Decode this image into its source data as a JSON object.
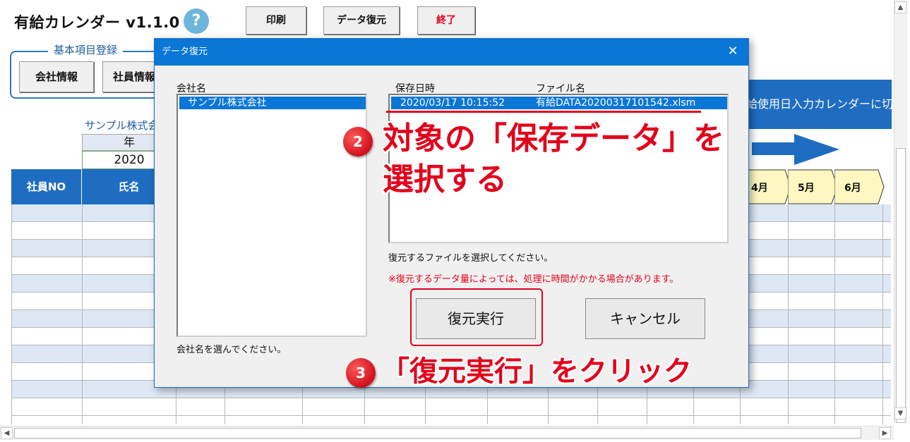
{
  "app": {
    "title": "有給カレンダー v1.1.0",
    "help_icon": "?",
    "buttons": {
      "print": "印刷",
      "restore": "データ復元",
      "exit": "終了"
    }
  },
  "basic_group": {
    "title": "基本項目登録",
    "company_info": "会社情報",
    "employee_info": "社員情報"
  },
  "sheet": {
    "company_name": "サンプル株式会",
    "year_header": "年",
    "year_value": "2020",
    "col_employee_no": "社員NO",
    "col_name": "氏名",
    "banner": "給使用日入力カレンダーに切り",
    "months": [
      "4月",
      "5月",
      "6月"
    ]
  },
  "dialog": {
    "title": "データ復元",
    "close": "✕",
    "company_list_label": "会社名",
    "company_items": [
      "サンプル株式会社"
    ],
    "company_hint": "会社名を選んでください。",
    "file_col_date": "保存日時",
    "file_col_name": "ファイル名",
    "file_items": [
      {
        "date": "2020/03/17 10:15:52",
        "name": "有給DATA20200317101542.xlsm"
      }
    ],
    "file_hint": "復元するファイルを選択してください。",
    "warning": "※復元するデータ量によっては、処理に時間がかかる場合があります。",
    "execute": "復元実行",
    "cancel": "キャンセル"
  },
  "annotations": {
    "step2_number": "2",
    "step2_line1": "対象の「保存データ」を",
    "step2_line2": "選択する",
    "step3_number": "3",
    "step3_text": "「復元実行」をクリック"
  },
  "colors": {
    "accent": "#1f6dc0",
    "title_bar": "#0a76d6",
    "annotation_red": "#e3001b",
    "row_alt": "#dde8f4",
    "month_fill": "#fff7c2"
  }
}
